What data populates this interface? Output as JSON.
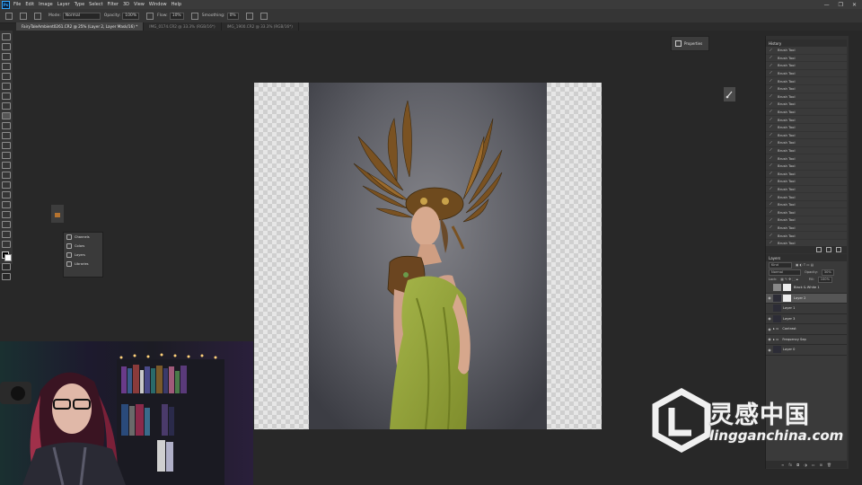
{
  "menubar": {
    "app_icon": "Ps",
    "items": [
      "File",
      "Edit",
      "Image",
      "Layer",
      "Type",
      "Select",
      "Filter",
      "3D",
      "View",
      "Window",
      "Help"
    ],
    "window_controls": [
      "—",
      "❐",
      "✕"
    ]
  },
  "options": {
    "mode_label": "Mode:",
    "mode_value": "Normal",
    "opacity_label": "Opacity:",
    "opacity_value": "100%",
    "flow_label": "Flow:",
    "flow_value": "10%",
    "smoothing_label": "Smoothing:",
    "smoothing_value": "0%"
  },
  "tabs": [
    {
      "label": "FairyTaleAmbient0261.CR2 @ 25% (Layer 2, Layer Mask/16) *",
      "active": true
    },
    {
      "label": "IMG_0174.CR2 @ 33.3% (RGB/16*)",
      "active": false
    },
    {
      "label": "IMG_1900.CR2 @ 33.3% (RGB/16*)",
      "active": false
    }
  ],
  "properties_button": "Properties",
  "panel_list": [
    "Channels",
    "Colors",
    "Layers",
    "Libraries"
  ],
  "history": {
    "title": "History",
    "items": [
      "Brush Tool",
      "Brush Tool",
      "Brush Tool",
      "Brush Tool",
      "Brush Tool",
      "Brush Tool",
      "Brush Tool",
      "Brush Tool",
      "Brush Tool",
      "Brush Tool",
      "Brush Tool",
      "Brush Tool",
      "Brush Tool",
      "Brush Tool",
      "Brush Tool",
      "Brush Tool",
      "Brush Tool",
      "Brush Tool",
      "Brush Tool",
      "Brush Tool",
      "Brush Tool",
      "Brush Tool",
      "Brush Tool",
      "Brush Tool",
      "Brush Tool",
      "Brush Tool",
      "Brush Tool",
      "Brush Tool"
    ]
  },
  "layers_panel": {
    "title": "Layers",
    "kind_label": "Kind",
    "blend_mode": "Normal",
    "opacity_label": "Opacity:",
    "opacity_value": "30%",
    "lock_label": "Lock:",
    "fill_label": "Fill:",
    "fill_value": "100%",
    "rows": [
      {
        "name": "Black & White 1",
        "type": "adjustment",
        "visible": false,
        "selected": false
      },
      {
        "name": "Layer 2",
        "type": "masked",
        "visible": true,
        "selected": true
      },
      {
        "name": "Layer 1",
        "type": "pixel",
        "visible": false,
        "selected": false
      },
      {
        "name": "Layer 3",
        "type": "pixel",
        "visible": true,
        "selected": false
      },
      {
        "name": "Contrast",
        "type": "group",
        "visible": true,
        "selected": false
      },
      {
        "name": "Frequency Sep",
        "type": "group",
        "visible": true,
        "selected": false
      },
      {
        "name": "Layer 0",
        "type": "pixel",
        "visible": true,
        "selected": false
      }
    ]
  },
  "watermark": {
    "cn": "灵感中国",
    "url": "lingganchina.com"
  },
  "colors": {
    "ui_dark": "#282828",
    "panel": "#3a3a3a",
    "accent": "#31a8ff",
    "dress_green": "#9aa83a",
    "headdress_bronze": "#8a5f2a"
  }
}
